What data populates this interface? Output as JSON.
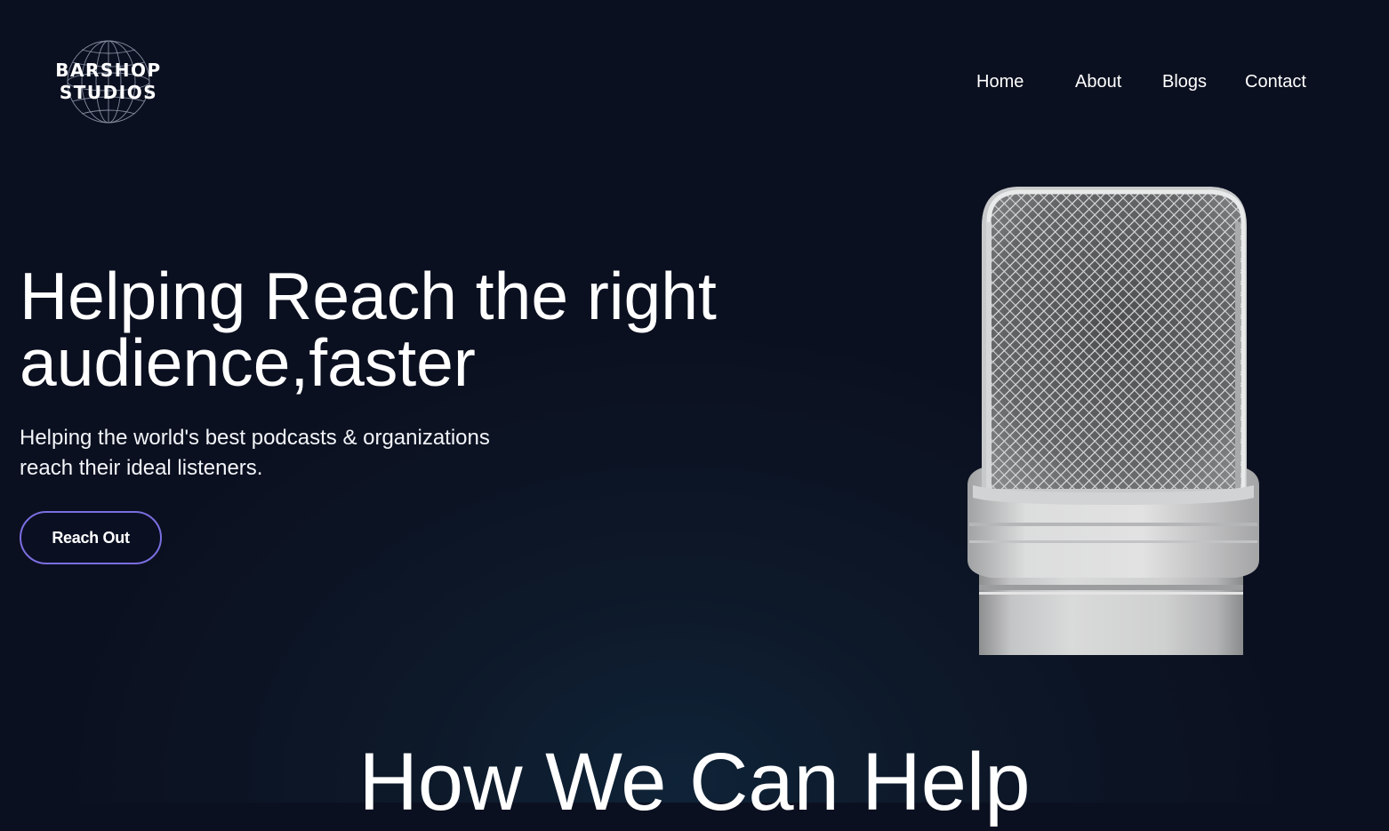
{
  "logo": {
    "line1": "BARSHOP",
    "line2": "STUDIOS",
    "icon": "globe-icon"
  },
  "nav": {
    "items": [
      {
        "label": "Home"
      },
      {
        "label": "About"
      },
      {
        "label": "Blogs"
      },
      {
        "label": "Contact"
      }
    ]
  },
  "hero": {
    "title_line1": "Helping Reach the right",
    "title_line2": "audience,faster",
    "subtitle_line1": "Helping the world's best podcasts & organizations",
    "subtitle_line2": "reach their ideal listeners.",
    "cta_label": "Reach Out",
    "image": "microphone-image"
  },
  "section": {
    "title": "How We Can Help"
  },
  "colors": {
    "background": "#0b1020",
    "accent_border": "#7b6ee0",
    "text": "#ffffff"
  }
}
